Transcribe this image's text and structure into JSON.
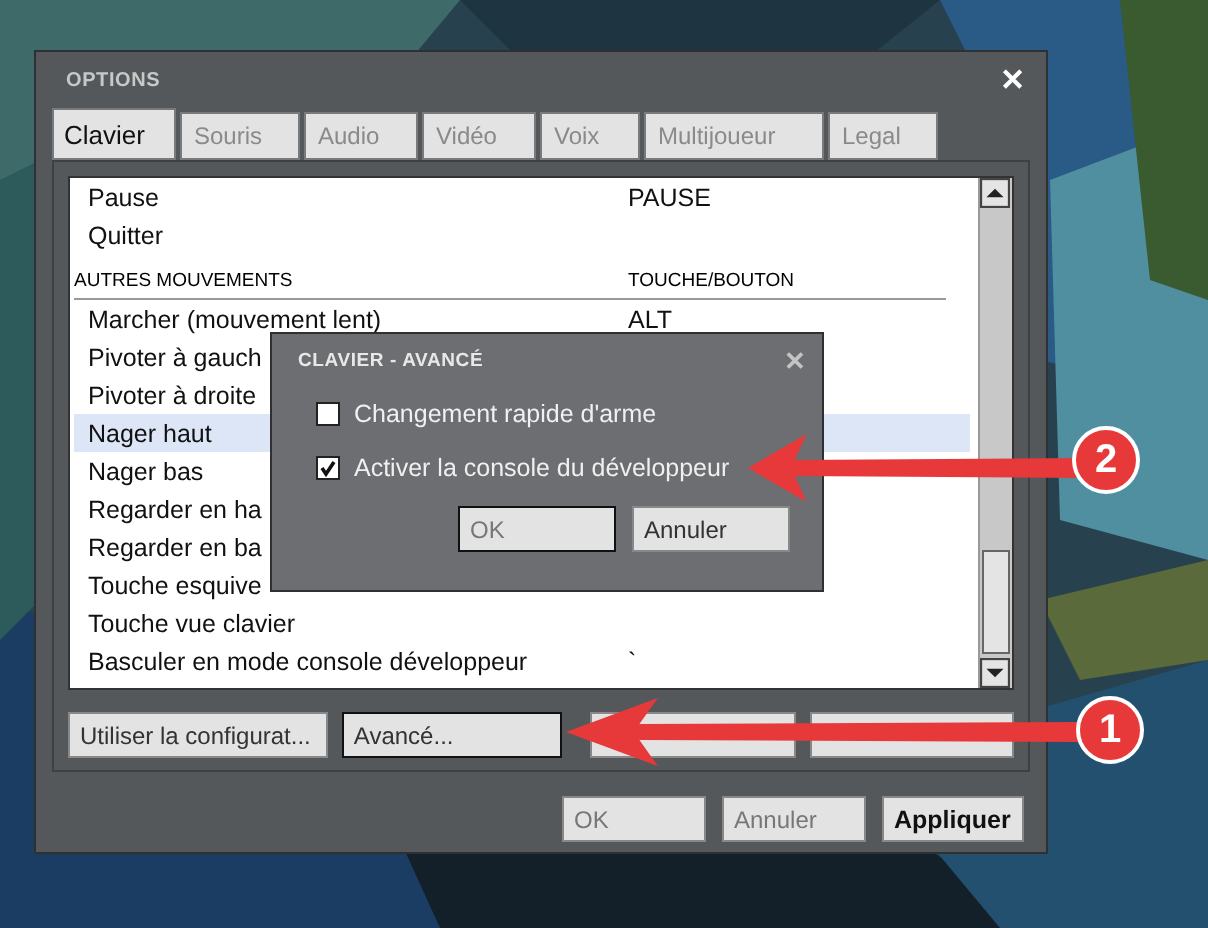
{
  "window": {
    "title": "OPTIONS",
    "close": "✕"
  },
  "tabs": [
    {
      "label": "Clavier",
      "selected": true
    },
    {
      "label": "Souris",
      "selected": false
    },
    {
      "label": "Audio",
      "selected": false
    },
    {
      "label": "Vidéo",
      "selected": false
    },
    {
      "label": "Voix",
      "selected": false
    },
    {
      "label": "Multijoueur",
      "selected": false
    },
    {
      "label": "Legal",
      "selected": false
    }
  ],
  "list": {
    "items": [
      {
        "kind": "binding",
        "action": "Pause",
        "key": "PAUSE",
        "selected": false
      },
      {
        "kind": "binding",
        "action": "Quitter",
        "selected": false
      },
      {
        "kind": "spacer"
      },
      {
        "kind": "header",
        "label": "AUTRES MOUVEMENTS",
        "column_2": "TOUCHE/BOUTON"
      },
      {
        "kind": "binding",
        "action": "Marcher (mouvement lent)",
        "key": "ALT",
        "selected": false
      },
      {
        "kind": "binding",
        "action": "Pivoter à gauch",
        "selected": false
      },
      {
        "kind": "binding",
        "action": "Pivoter à droite",
        "selected": false
      },
      {
        "kind": "binding",
        "action": "Nager haut",
        "selected": true
      },
      {
        "kind": "binding",
        "action": "Nager bas",
        "selected": false
      },
      {
        "kind": "binding",
        "action": "Regarder en ha",
        "selected": false
      },
      {
        "kind": "binding",
        "action": "Regarder en ba",
        "selected": false
      },
      {
        "kind": "binding",
        "action": "Touche esquive",
        "selected": false
      },
      {
        "kind": "binding",
        "action": "Touche vue clavier",
        "selected": false
      },
      {
        "kind": "binding",
        "action": "Basculer en mode console développeur",
        "key": "`",
        "selected": false
      }
    ]
  },
  "list_buttons": [
    {
      "label": "Utiliser la configurat...",
      "focused": false
    },
    {
      "label": "Avancé...",
      "focused": true
    },
    {
      "focused": false
    },
    {
      "focused": false
    }
  ],
  "footer_buttons": [
    {
      "label": "OK",
      "disabled": true
    },
    {
      "label": "Annuler",
      "disabled": true
    },
    {
      "label": "Appliquer",
      "disabled": false
    }
  ],
  "dialog": {
    "title": "CLAVIER - AVANCÉ",
    "close": "✕",
    "options": [
      {
        "label": "Changement rapide d'arme",
        "checked": false
      },
      {
        "label": "Activer la console du développeur",
        "checked": true
      }
    ],
    "buttons": [
      {
        "label": "OK",
        "focused": true
      },
      {
        "label": "Annuler",
        "focused": false
      }
    ]
  },
  "annotations": [
    {
      "number": "2"
    },
    {
      "number": "1"
    }
  ]
}
